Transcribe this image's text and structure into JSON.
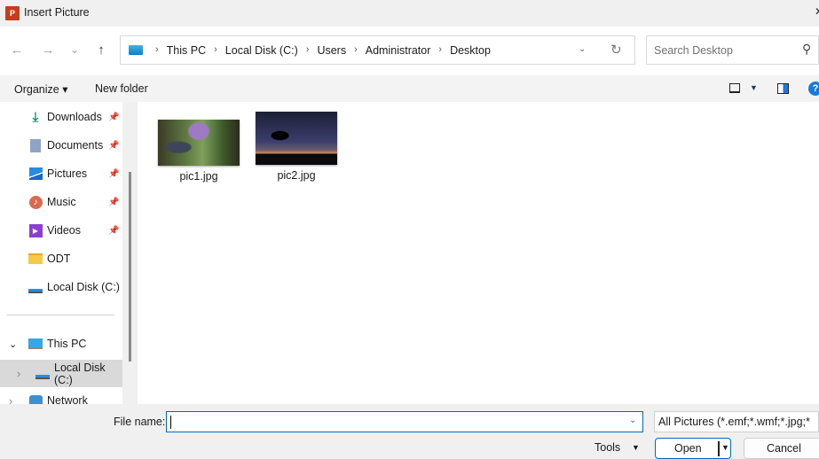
{
  "window": {
    "title": "Insert Picture",
    "app_icon": "P"
  },
  "nav": {
    "back": "←",
    "forward": "→",
    "recent": "⌄",
    "up": "↑",
    "breadcrumb": [
      "This PC",
      "Local Disk (C:)",
      "Users",
      "Administrator",
      "Desktop"
    ],
    "search_placeholder": "Search Desktop"
  },
  "toolbar": {
    "organize": "Organize ▾",
    "new_folder": "New folder",
    "help": "?"
  },
  "sidebar": {
    "items": [
      {
        "label": "Downloads",
        "icon": "download-icon",
        "pinned": true
      },
      {
        "label": "Documents",
        "icon": "documents-icon",
        "pinned": true
      },
      {
        "label": "Pictures",
        "icon": "pictures-icon",
        "pinned": true
      },
      {
        "label": "Music",
        "icon": "music-icon",
        "pinned": true
      },
      {
        "label": "Videos",
        "icon": "videos-icon",
        "pinned": true
      },
      {
        "label": "ODT",
        "icon": "folder-icon",
        "pinned": false
      },
      {
        "label": "Local Disk (C:)",
        "icon": "drive-icon",
        "pinned": false
      }
    ],
    "tree": [
      {
        "label": "This PC",
        "expander": "⌄"
      },
      {
        "label": "Local Disk (C:)",
        "expander": "›",
        "selected": true
      },
      {
        "label": "Network",
        "expander": "›"
      }
    ]
  },
  "files": [
    {
      "name": "pic1.jpg"
    },
    {
      "name": "pic2.jpg"
    }
  ],
  "footer": {
    "file_name_label": "File name:",
    "file_name_value": "",
    "filter": "All Pictures (*.emf;*.wmf;*.jpg;*",
    "tools": "Tools",
    "open": "Open",
    "cancel": "Cancel"
  }
}
